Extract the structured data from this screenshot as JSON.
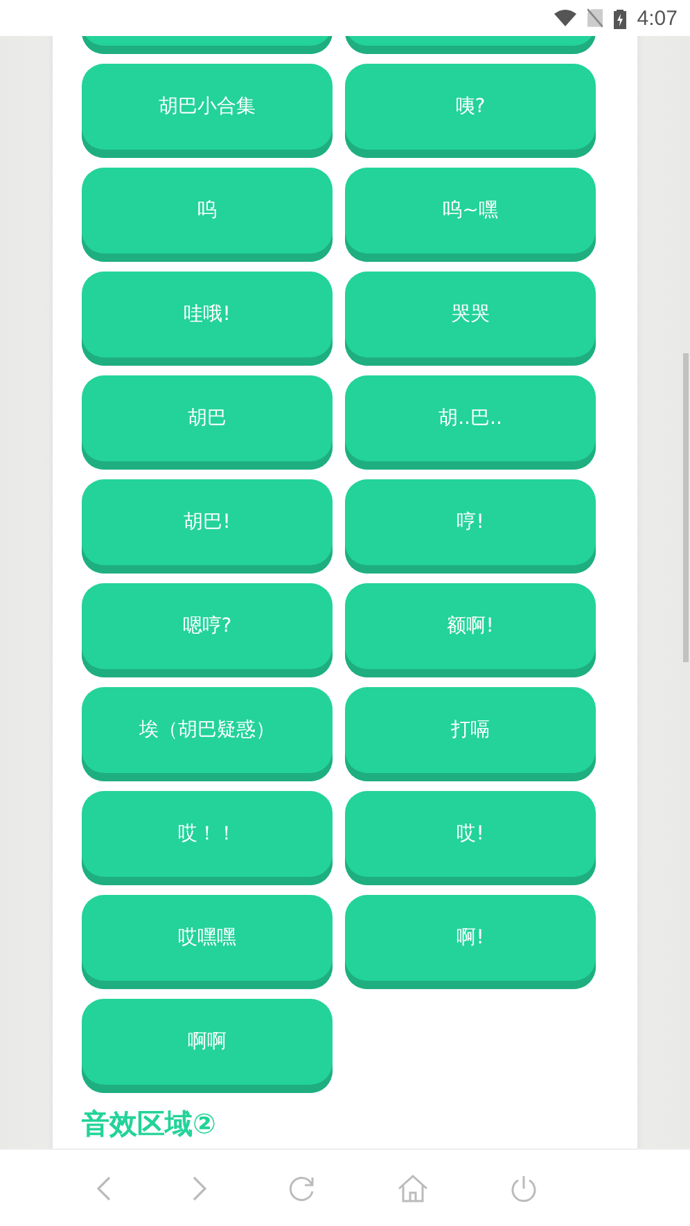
{
  "status_bar": {
    "time": "4:07"
  },
  "sound_buttons": [
    {
      "kind": "cut_off"
    },
    {
      "kind": "cut_off"
    },
    {
      "label": "胡巴小合集"
    },
    {
      "label": "咦?"
    },
    {
      "label": "呜"
    },
    {
      "label": "呜~嘿"
    },
    {
      "label": "哇哦!"
    },
    {
      "label": "哭哭"
    },
    {
      "label": "胡巴"
    },
    {
      "label": "胡..巴.."
    },
    {
      "label": "胡巴!"
    },
    {
      "label": "哼!"
    },
    {
      "label": "嗯哼?"
    },
    {
      "label": "额啊!"
    },
    {
      "label": "埃（胡巴疑惑）"
    },
    {
      "label": "打嗝"
    },
    {
      "label": "哎！！"
    },
    {
      "label": "哎!"
    },
    {
      "label": "哎嘿嘿"
    },
    {
      "label": "啊!"
    },
    {
      "label": "啊啊"
    }
  ],
  "section_heading": "音效区域②"
}
